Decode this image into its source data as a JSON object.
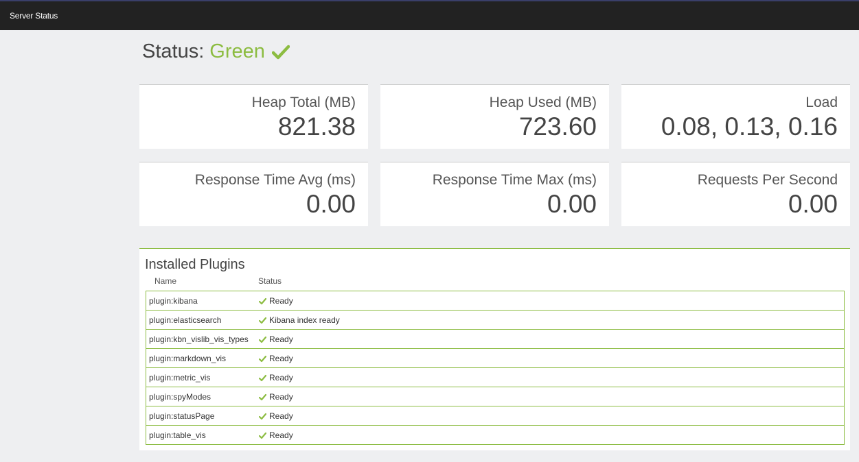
{
  "topbar": {
    "title": "Server Status"
  },
  "status": {
    "prefix": "Status:",
    "state": "Green",
    "icon": "check-icon",
    "color": "#8cbc41"
  },
  "metrics": [
    {
      "label": "Heap Total (MB)",
      "value": "821.38"
    },
    {
      "label": "Heap Used (MB)",
      "value": "723.60"
    },
    {
      "label": "Load",
      "value": "0.08, 0.13, 0.16"
    },
    {
      "label": "Response Time Avg (ms)",
      "value": "0.00"
    },
    {
      "label": "Response Time Max (ms)",
      "value": "0.00"
    },
    {
      "label": "Requests Per Second",
      "value": "0.00"
    }
  ],
  "plugins": {
    "title": "Installed Plugins",
    "columns": {
      "name": "Name",
      "status": "Status"
    },
    "rows": [
      {
        "name": "plugin:kibana",
        "status": "Ready"
      },
      {
        "name": "plugin:elasticsearch",
        "status": "Kibana index ready"
      },
      {
        "name": "plugin:kbn_vislib_vis_types",
        "status": "Ready"
      },
      {
        "name": "plugin:markdown_vis",
        "status": "Ready"
      },
      {
        "name": "plugin:metric_vis",
        "status": "Ready"
      },
      {
        "name": "plugin:spyModes",
        "status": "Ready"
      },
      {
        "name": "plugin:statusPage",
        "status": "Ready"
      },
      {
        "name": "plugin:table_vis",
        "status": "Ready"
      }
    ]
  }
}
